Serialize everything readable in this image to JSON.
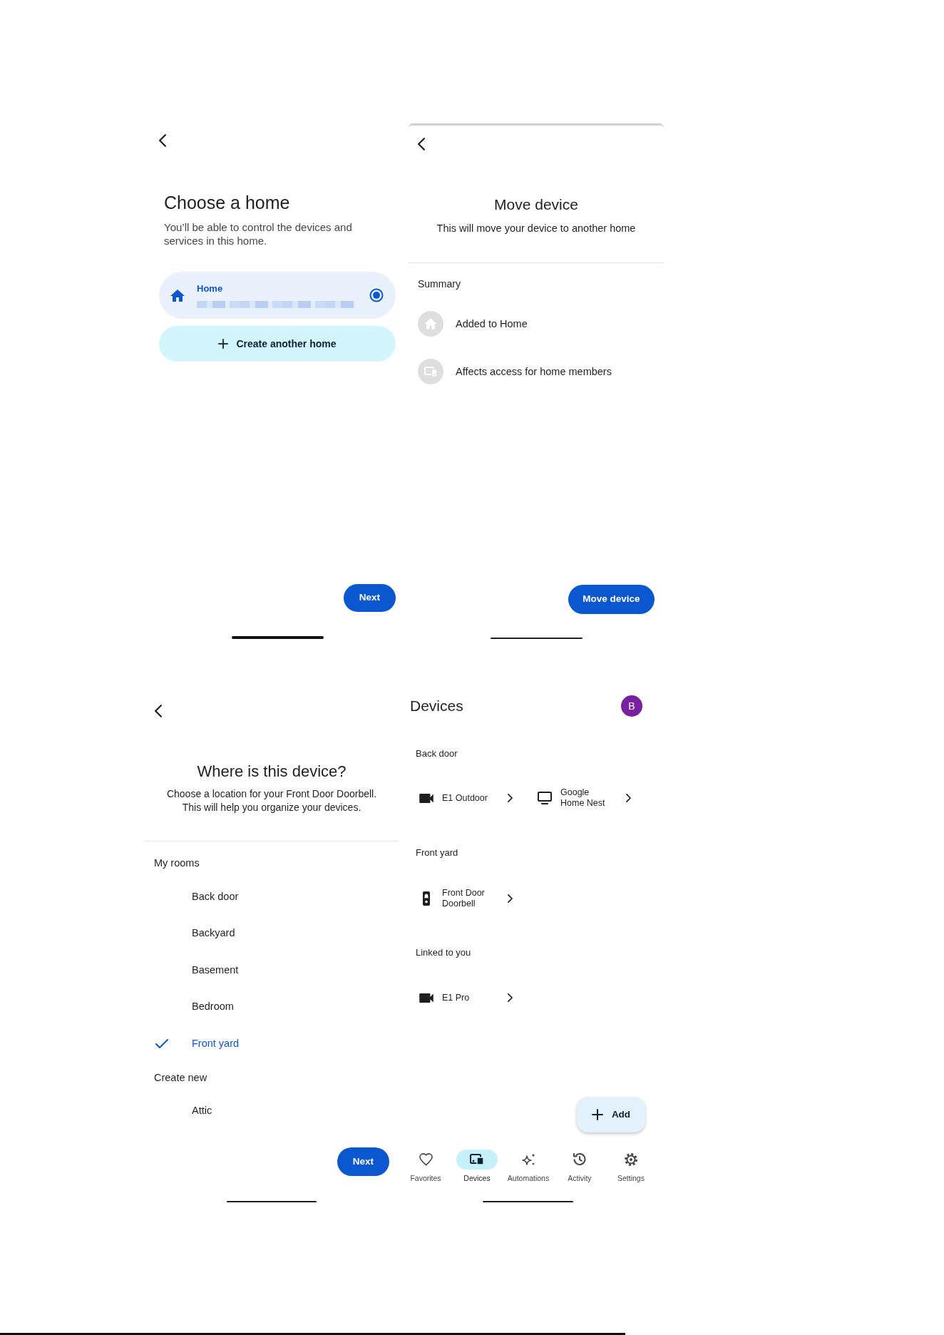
{
  "screens": [
    {
      "kind": "choose_home",
      "title": "Choose a home",
      "subtitle": "You’ll be able to control the devices and services in this home.",
      "homes": [
        {
          "name": "Home",
          "selected": true
        }
      ],
      "create_button": "Create another home",
      "next_button": "Next"
    },
    {
      "kind": "move_device",
      "title": "Move device",
      "subtitle": "This will move your device to another home",
      "summary_heading": "Summary",
      "summary_items": [
        {
          "kind": "home",
          "text": "Added to Home"
        },
        {
          "kind": "devices",
          "text": "Affects access for home members"
        }
      ],
      "action_button": "Move device"
    },
    {
      "kind": "room_picker",
      "title": "Where is this device?",
      "subtitle": "Choose a location for your Front Door Doorbell. This will help you organize your devices.",
      "sections": [
        {
          "heading": "My rooms",
          "rooms": [
            {
              "name": "Back door",
              "selected": false
            },
            {
              "name": "Backyard",
              "selected": false
            },
            {
              "name": "Basement",
              "selected": false
            },
            {
              "name": "Bedroom",
              "selected": false
            },
            {
              "name": "Front yard",
              "selected": true
            }
          ]
        },
        {
          "heading": "Create new",
          "rooms": [
            {
              "name": "Attic",
              "selected": false
            }
          ]
        }
      ],
      "next_button": "Next"
    },
    {
      "kind": "device_list",
      "title": "Devices",
      "avatar": "B",
      "groups": [
        {
          "heading": "Back door",
          "devices": [
            {
              "kind": "camera",
              "name": "E1 Outdoor"
            },
            {
              "kind": "display",
              "name": "Google Home Nest"
            }
          ]
        },
        {
          "heading": "Front yard",
          "devices": [
            {
              "kind": "doorbell",
              "name": "Front Door Doorbell"
            }
          ]
        },
        {
          "heading": "Linked to you",
          "devices": [
            {
              "kind": "camera",
              "name": "E1 Pro"
            }
          ]
        }
      ],
      "add_button": "Add",
      "nav": [
        {
          "kind": "heart",
          "label": "Favorites",
          "selected": false
        },
        {
          "kind": "devices",
          "label": "Devices",
          "selected": true
        },
        {
          "kind": "sparkle",
          "label": "Automations",
          "selected": false
        },
        {
          "kind": "history",
          "label": "Activity",
          "selected": false
        },
        {
          "kind": "gear",
          "label": "Settings",
          "selected": false
        }
      ]
    }
  ]
}
